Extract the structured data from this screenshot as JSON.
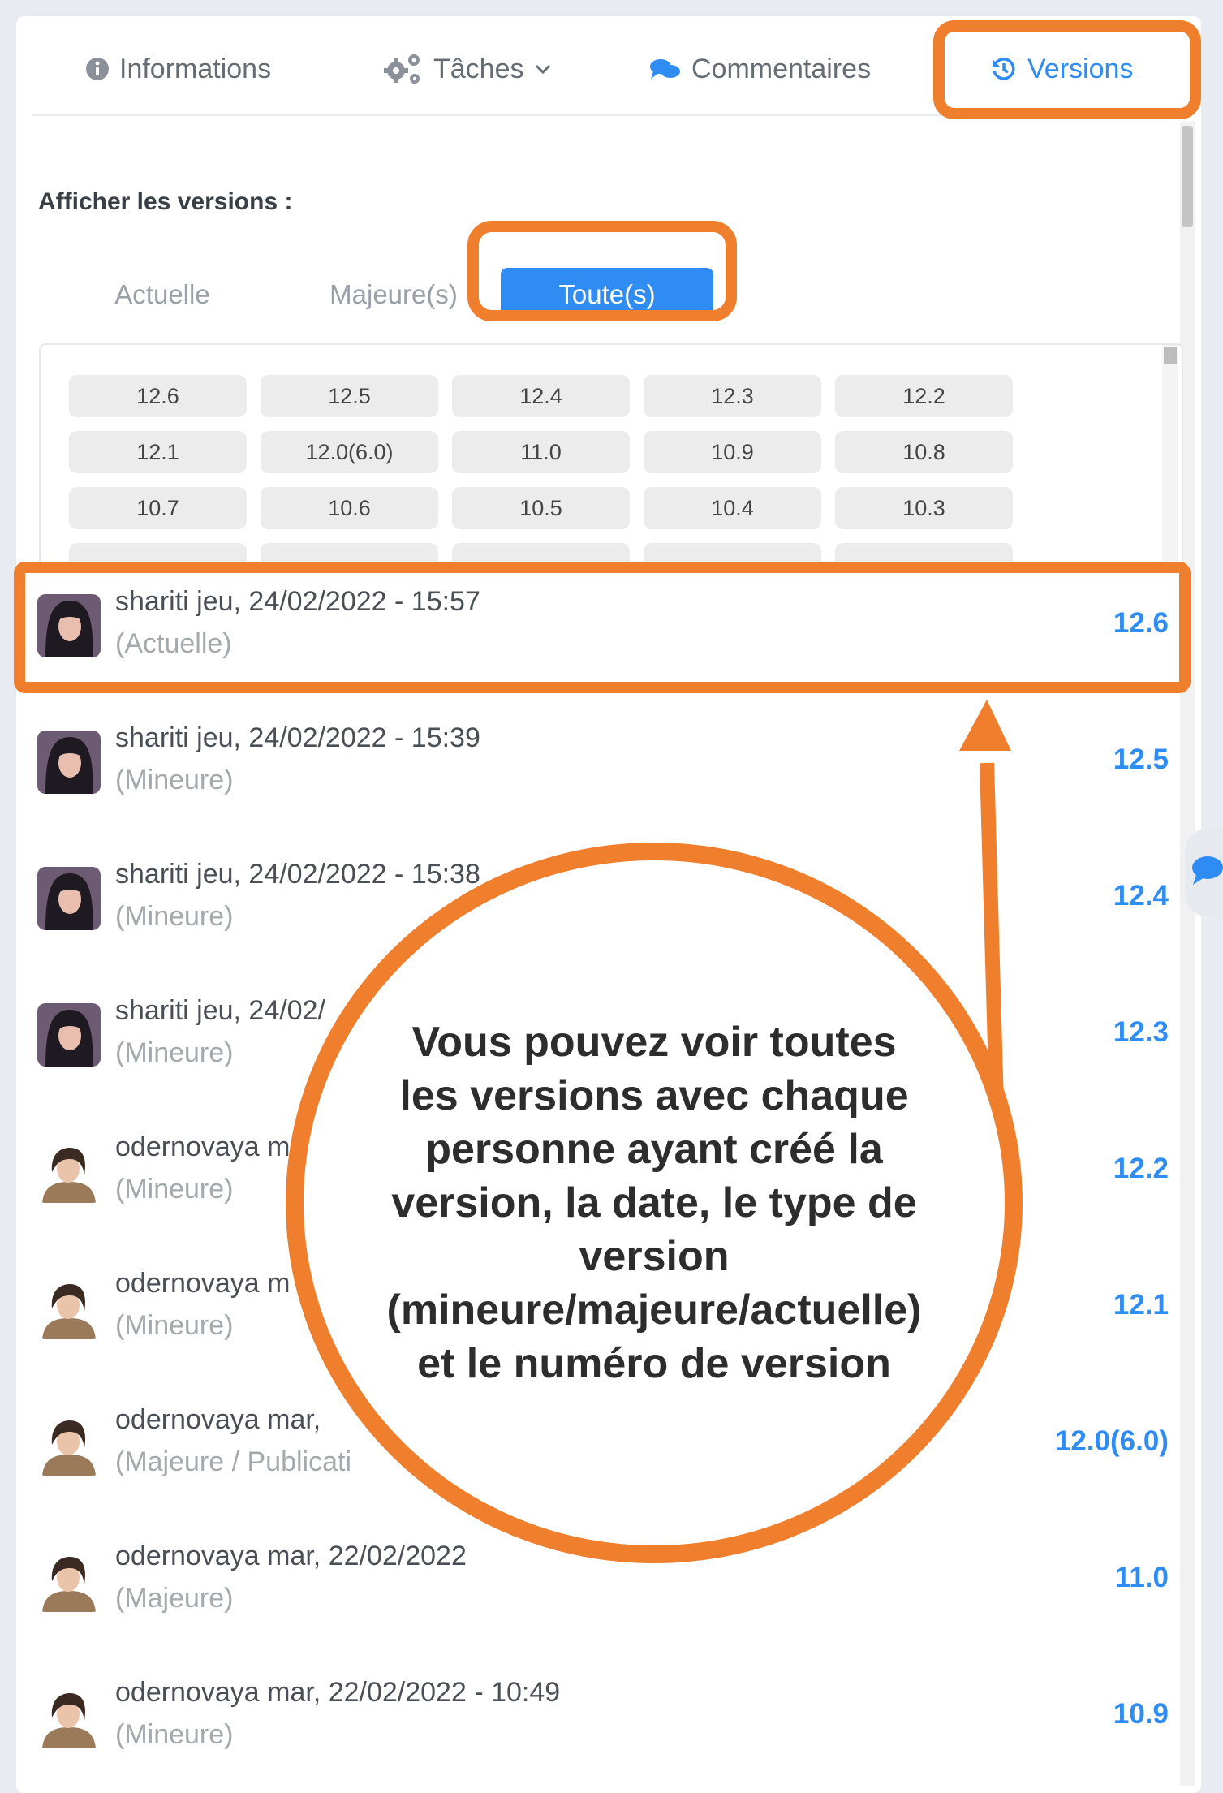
{
  "tabs": [
    {
      "label": "Informations",
      "icon": "info-icon",
      "active": false
    },
    {
      "label": "Tâches",
      "icon": "gears-icon",
      "active": false
    },
    {
      "label": "Commentaires",
      "icon": "comments-icon",
      "active": false
    },
    {
      "label": "Versions",
      "icon": "history-icon",
      "active": true
    }
  ],
  "filters": {
    "heading": "Afficher les versions :",
    "options": [
      {
        "label": "Actuelle",
        "active": false
      },
      {
        "label": "Majeure(s)",
        "active": false
      },
      {
        "label": "Toute(s)",
        "active": true
      }
    ]
  },
  "version_chips": [
    "12.6",
    "12.5",
    "12.4",
    "12.3",
    "12.2",
    "12.1",
    "12.0(6.0)",
    "11.0",
    "10.9",
    "10.8",
    "10.7",
    "10.6",
    "10.5",
    "10.4",
    "10.3"
  ],
  "version_rows": [
    {
      "title": "shariti jeu, 24/02/2022 - 15:57",
      "type": "(Actuelle)",
      "version": "12.6",
      "avatar": "dark-hair"
    },
    {
      "title": "shariti jeu, 24/02/2022 - 15:39",
      "type": "(Mineure)",
      "version": "12.5",
      "avatar": "dark-hair"
    },
    {
      "title": "shariti jeu, 24/02/2022 - 15:38",
      "type": "(Mineure)",
      "version": "12.4",
      "avatar": "dark-hair"
    },
    {
      "title": "shariti jeu, 24/02/",
      "type": "(Mineure)",
      "version": "12.3",
      "avatar": "dark-hair"
    },
    {
      "title": "odernovaya m",
      "type": "(Mineure)",
      "version": "12.2",
      "avatar": "bob-hair"
    },
    {
      "title": "odernovaya m",
      "type": "(Mineure)",
      "version": "12.1",
      "avatar": "bob-hair"
    },
    {
      "title": "odernovaya mar,",
      "type": "(Majeure / Publicati",
      "version": "12.0(6.0)",
      "avatar": "bob-hair"
    },
    {
      "title": "odernovaya mar, 22/02/2022",
      "type": "(Majeure)",
      "version": "11.0",
      "avatar": "bob-hair"
    },
    {
      "title": "odernovaya mar, 22/02/2022 - 10:49",
      "type": "(Mineure)",
      "version": "10.9",
      "avatar": "bob-hair"
    }
  ],
  "callout": {
    "text": "Vous pouvez voir toutes les versions avec chaque personne ayant créé la version, la date, le type de version (mineure/majeure/actuelle) et le numéro de version"
  },
  "colors": {
    "accent": "#2f8cf3",
    "highlight": "#ef7e2d"
  }
}
